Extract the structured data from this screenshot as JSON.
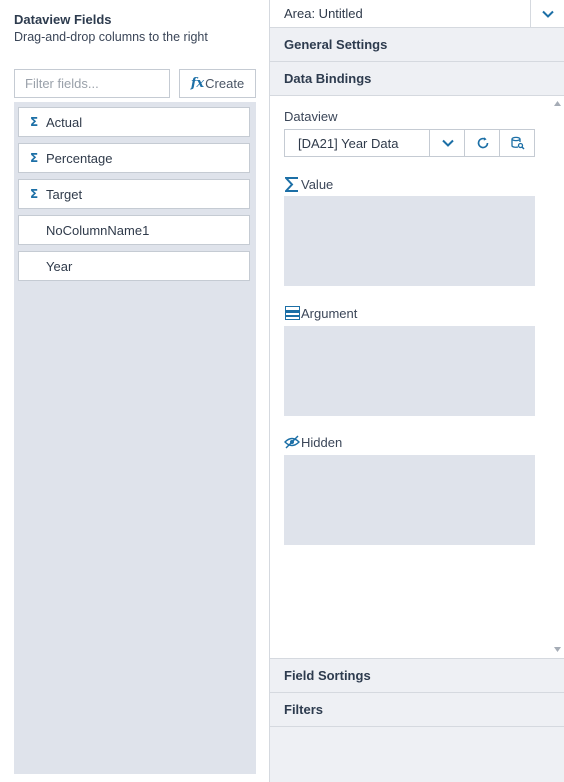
{
  "left_panel": {
    "title": "Dataview Fields",
    "subtitle": "Drag-and-drop columns to the right",
    "filter_placeholder": "Filter fields...",
    "create_label": "Create",
    "create_icon_text": "fx",
    "fields": [
      {
        "label": "Actual",
        "icon": "sigma-icon"
      },
      {
        "label": "Percentage",
        "icon": "sigma-icon"
      },
      {
        "label": "Target",
        "icon": "sigma-icon"
      },
      {
        "label": "NoColumnName1",
        "icon": null
      },
      {
        "label": "Year",
        "icon": null
      }
    ]
  },
  "right_panel": {
    "area_label": "Area: Untitled",
    "sections": {
      "general_settings": "General Settings",
      "data_bindings": "Data Bindings",
      "field_sortings": "Field Sortings",
      "filters": "Filters"
    },
    "dataview": {
      "label": "Dataview",
      "selected": "[DA21] Year Data"
    },
    "bindings": {
      "value": "Value",
      "argument": "Argument",
      "hidden": "Hidden"
    }
  },
  "colors": {
    "accent": "#1c6fa6",
    "drop_zone": "#dfe3eb",
    "panel_bg": "#eef0f4"
  }
}
